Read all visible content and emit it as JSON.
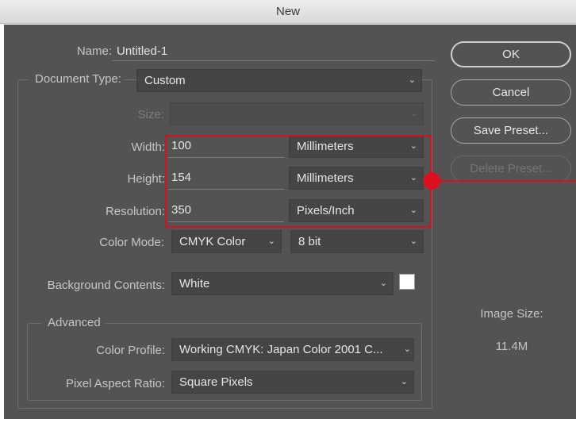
{
  "window": {
    "title": "New"
  },
  "name": {
    "label": "Name:",
    "value": "Untitled-1"
  },
  "document_type": {
    "label": "Document Type:",
    "value": "Custom"
  },
  "size": {
    "label": "Size:",
    "value": ""
  },
  "width": {
    "label": "Width:",
    "value": "100",
    "unit": "Millimeters"
  },
  "height": {
    "label": "Height:",
    "value": "154",
    "unit": "Millimeters"
  },
  "resolution": {
    "label": "Resolution:",
    "value": "350",
    "unit": "Pixels/Inch"
  },
  "color_mode": {
    "label": "Color Mode:",
    "mode": "CMYK Color",
    "depth": "8 bit"
  },
  "background": {
    "label": "Background Contents:",
    "value": "White",
    "swatch_color": "#ffffff"
  },
  "advanced": {
    "legend": "Advanced",
    "color_profile": {
      "label": "Color Profile:",
      "value": "Working CMYK:  Japan Color 2001 C..."
    },
    "pixel_aspect": {
      "label": "Pixel Aspect Ratio:",
      "value": "Square Pixels"
    }
  },
  "buttons": {
    "ok": "OK",
    "cancel": "Cancel",
    "save_preset": "Save Preset...",
    "delete_preset": "Delete Preset..."
  },
  "image_size": {
    "label": "Image Size:",
    "value": "11.4M"
  },
  "icons": {
    "dropdown": "chevron-down-icon"
  },
  "colors": {
    "dialog_bg": "#535353",
    "highlight": "#dc0f1f"
  }
}
